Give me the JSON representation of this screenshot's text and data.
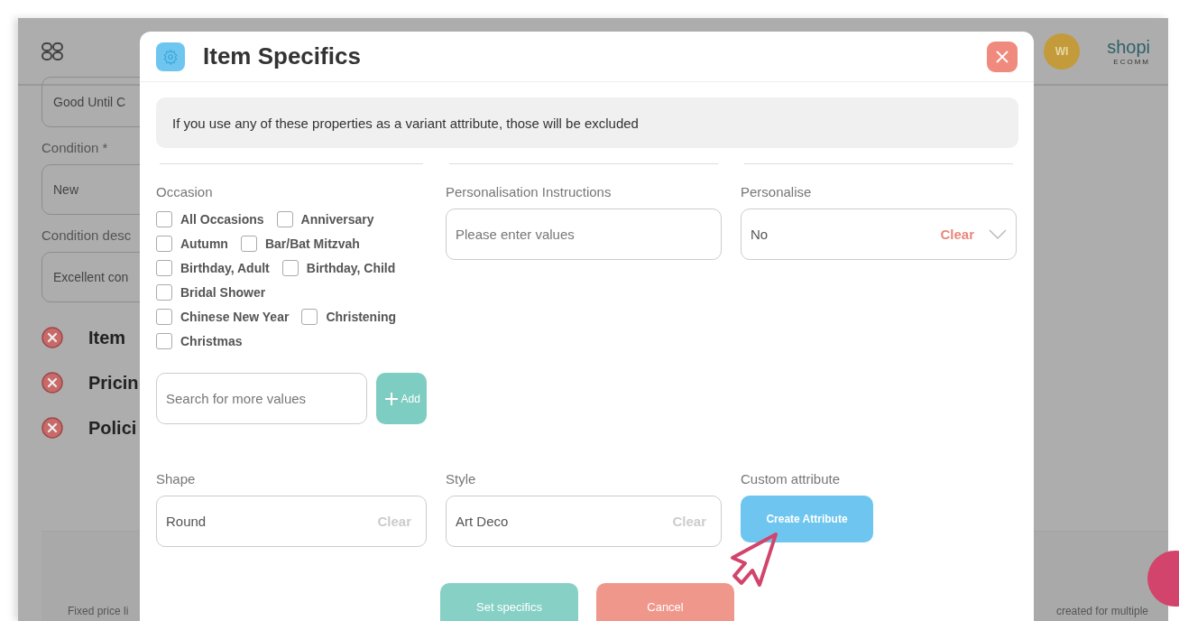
{
  "background": {
    "header": {
      "avatar": "WI",
      "logo": "shopi",
      "logo_tagline": "ECOMM"
    },
    "fields": [
      {
        "value": "Good Until C"
      },
      {
        "label": "Condition *",
        "value": "New"
      },
      {
        "label": "Condition desc",
        "value": "Excellent con"
      }
    ],
    "sections": [
      {
        "title": "Item"
      },
      {
        "title": "Pricin"
      },
      {
        "title": "Polici"
      }
    ],
    "footer_left": "Fixed price li",
    "footer_right": "created for multiple"
  },
  "modal": {
    "title": "Item Specifics",
    "notice": "If you use any of these properties as a variant attribute, those will be excluded",
    "occasion": {
      "label": "Occasion",
      "option_rows": [
        [
          {
            "label": "All Occasions",
            "checked": false
          },
          {
            "label": "Anniversary",
            "checked": false
          }
        ],
        [
          {
            "label": "Autumn",
            "checked": false
          },
          {
            "label": "Bar/Bat Mitzvah",
            "checked": false
          }
        ],
        [
          {
            "label": "Birthday, Adult",
            "checked": false
          },
          {
            "label": "Birthday, Child",
            "checked": false
          }
        ],
        [
          {
            "label": "Bridal Shower",
            "checked": false
          }
        ],
        [
          {
            "label": "Chinese New Year",
            "checked": false
          },
          {
            "label": "Christening",
            "checked": false
          }
        ],
        [
          {
            "label": "Christmas",
            "checked": false
          }
        ]
      ],
      "search_placeholder": "Search for more values",
      "add_button": "Add"
    },
    "personalisation_instructions": {
      "label": "Personalisation Instructions",
      "placeholder": "Please enter values"
    },
    "personalise": {
      "label": "Personalise",
      "value": "No",
      "clear": {
        "label": "Clear",
        "disabled": false
      }
    },
    "shape": {
      "label": "Shape",
      "value": "Round",
      "clear": {
        "label": "Clear",
        "disabled": true
      }
    },
    "style": {
      "label": "Style",
      "value": "Art Deco",
      "clear": {
        "label": "Clear",
        "disabled": true
      }
    },
    "custom_attribute": {
      "label": "Custom attribute",
      "button": "Create Attribute"
    },
    "buttons": [
      {
        "label": "Set specifics",
        "kind": "primary"
      },
      {
        "label": "Cancel",
        "kind": "secondary"
      }
    ]
  }
}
